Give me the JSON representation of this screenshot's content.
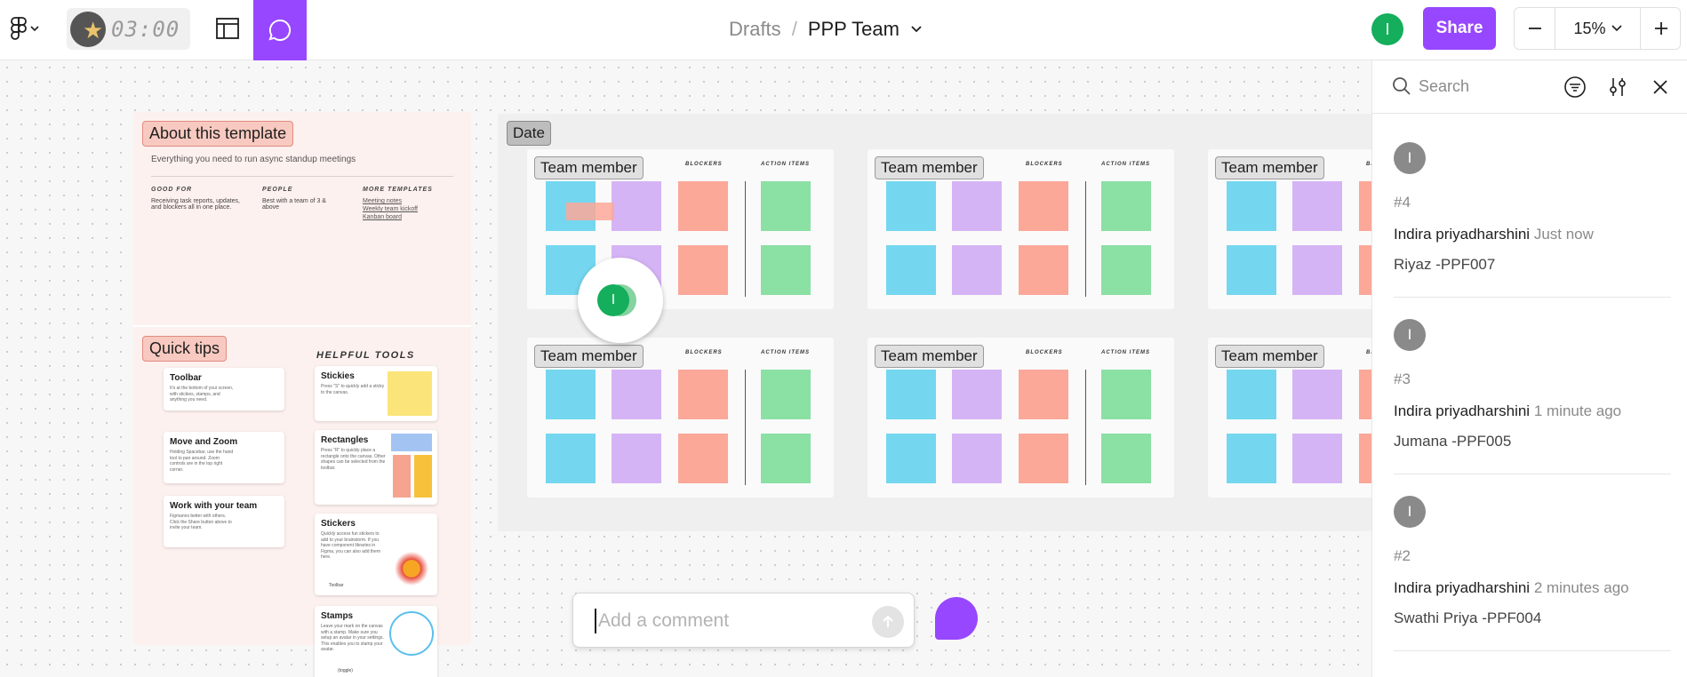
{
  "timer": {
    "value": "03:00"
  },
  "breadcrumb": {
    "location": "Drafts",
    "separator": "/",
    "file_name": "PPP Team"
  },
  "user": {
    "initial": "I"
  },
  "share": {
    "label": "Share"
  },
  "zoom": {
    "value": "15%"
  },
  "accent_color": "#9747ff",
  "template": {
    "about_tag": "About this template",
    "subtitle": "Everything you need to run async standup meetings",
    "columns": [
      {
        "heading": "GOOD FOR",
        "text": "Receiving task reports, updates, and blockers all in one place."
      },
      {
        "heading": "PEOPLE",
        "text": "Best with a team of 3 & above"
      },
      {
        "heading": "MORE TEMPLATES",
        "links": [
          "Meeting notes",
          "Weekly team kickoff",
          "Kanban board"
        ]
      }
    ],
    "quick_tips_tag": "Quick tips",
    "tools_heading": "HELPFUL TOOLS",
    "tips": [
      {
        "title": "Toolbar",
        "desc": "It's at the bottom of your screen, with stickies, stamps, and anything you need."
      },
      {
        "title": "Move and Zoom",
        "desc": "Holding Spacebar, use the hand tool to pan around. Zoom controls are in the top right corner."
      },
      {
        "title": "Work with your team",
        "desc": "Figmanns better with others. Click the Share button above to invite your team."
      }
    ],
    "tools": [
      {
        "title": "Stickies",
        "desc": "Press \"S\" to quickly add a sticky to the canvas."
      },
      {
        "title": "Rectangles",
        "desc": "Press \"R\" to quickly place a rectangle onto the canvas. Other shapes can be selected from the toolbar."
      },
      {
        "title": "Stickers",
        "desc": "Quickly access fun stickers to add to your brainstorm. If you have component libraries in Figma, you can also add them here.",
        "footer": "Toolbar"
      },
      {
        "title": "Stamps",
        "desc": "Leave your mark on the canvas with a stamp. Make sure you setup an avatar in your settings. This enables you to stamp your avatar.",
        "footer": "(toggle)"
      }
    ]
  },
  "board": {
    "date_label": "Date",
    "frame_label": "Team member",
    "blockers_label": "BLOCKERS",
    "action_items_label": "ACTION ITEMS",
    "colors": {
      "blue": "#74d7ef",
      "purple": "#d5b4f5",
      "red": "#fba899",
      "green": "#8be0a4"
    }
  },
  "composer": {
    "placeholder": "Add a comment"
  },
  "panel": {
    "search_placeholder": "Search",
    "comments": [
      {
        "initial": "I",
        "number": "#4",
        "author": "Indira priyadharshini",
        "time": "Just now",
        "body": "Riyaz -PPF007"
      },
      {
        "initial": "I",
        "number": "#3",
        "author": "Indira priyadharshini",
        "time": "1 minute ago",
        "body": "Jumana -PPF005"
      },
      {
        "initial": "I",
        "number": "#2",
        "author": "Indira priyadharshini",
        "time": "2 minutes ago",
        "body": "Swathi Priya -PPF004"
      }
    ]
  }
}
